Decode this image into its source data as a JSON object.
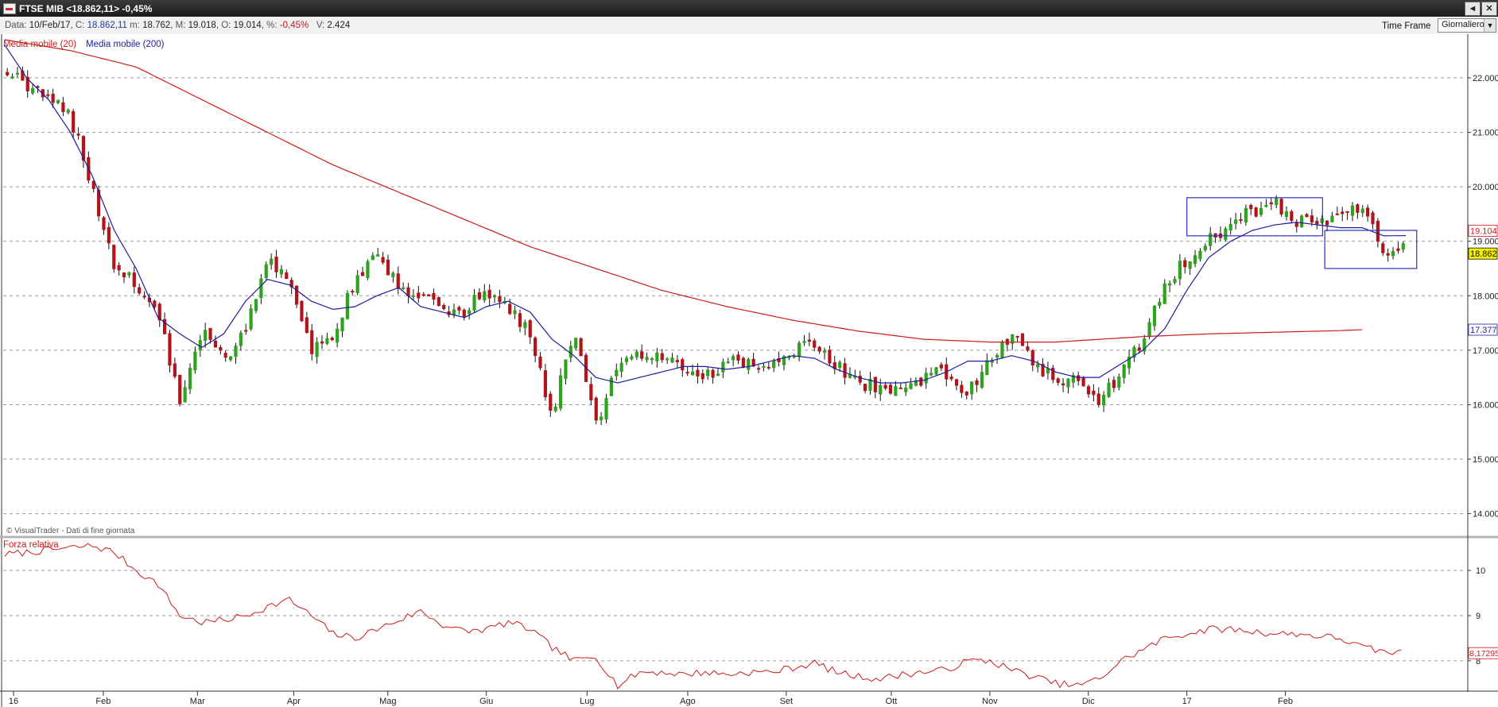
{
  "window": {
    "title": "FTSE MIB <18.862,11> -0,45%",
    "buttons": [
      "◄",
      "✕"
    ]
  },
  "infobar": {
    "data_label": "Data:",
    "date": "10/Feb/17",
    "close_label": "C:",
    "close": "18.862,11",
    "min_label": "m:",
    "min": "18.762",
    "max_label": "M:",
    "max": "19.018",
    "open_label": "O:",
    "open": "19.014",
    "pct_label": "%:",
    "pct": "-0,45%",
    "vol_label": "V:",
    "vol": "2.424",
    "timeframe_label": "Time Frame",
    "timeframe_value": "Giornaliero"
  },
  "colors": {
    "up": "#2ea31f",
    "down": "#b2141a",
    "ma20": "#cc1b1b",
    "ma200": "#1c1ca0",
    "rs": "#cc1b1b",
    "box": "#3030c0",
    "last_price_bg": "#f3f000",
    "grid": "#9a9a9a"
  },
  "chart_data": [
    {
      "type": "candlestick",
      "name": "price",
      "legend": [
        "Media mobile (20)",
        "Media mobile (200)"
      ],
      "copyright": "© VisualTrader - Dati di fine giornata",
      "x_labels": [
        "16",
        "Feb",
        "Mar",
        "Apr",
        "Mag",
        "Giu",
        "Lug",
        "Ago",
        "Set",
        "Ott",
        "Nov",
        "Dic",
        "17",
        "Feb"
      ],
      "x_label_week_index": [
        0.4,
        4.5,
        8.8,
        13.2,
        17.5,
        22,
        26.6,
        31.2,
        35.7,
        40.5,
        45,
        49.5,
        54,
        58.5
      ],
      "y_ticks": [
        "14.000",
        "15.000",
        "16.000",
        "17.000",
        "18.000",
        "19.000",
        "20.000",
        "21.000",
        "22.000"
      ],
      "y_tick_values": [
        14000,
        15000,
        16000,
        17000,
        18000,
        19000,
        20000,
        21000,
        22000
      ],
      "ylim": [
        13600,
        22700
      ],
      "weeks": 64,
      "anchors": [
        [
          0,
          22150
        ],
        [
          3,
          21300
        ],
        [
          4,
          20000
        ],
        [
          5,
          18500
        ],
        [
          6,
          18200
        ],
        [
          7,
          17700
        ],
        [
          8,
          16000
        ],
        [
          9,
          17400
        ],
        [
          10,
          16800
        ],
        [
          11,
          17400
        ],
        [
          12,
          18700
        ],
        [
          13,
          18200
        ],
        [
          14,
          17000
        ],
        [
          15,
          17200
        ],
        [
          16,
          18300
        ],
        [
          17,
          18700
        ],
        [
          18,
          18200
        ],
        [
          20,
          17800
        ],
        [
          21,
          17700
        ],
        [
          22,
          18100
        ],
        [
          23,
          17800
        ],
        [
          24,
          17300
        ],
        [
          25,
          15800
        ],
        [
          26,
          17400
        ],
        [
          27,
          15600
        ],
        [
          28,
          16700
        ],
        [
          29,
          16900
        ],
        [
          31,
          16700
        ],
        [
          32,
          16500
        ],
        [
          33,
          16800
        ],
        [
          34,
          16700
        ],
        [
          35,
          16700
        ],
        [
          36,
          17000
        ],
        [
          37,
          17100
        ],
        [
          38,
          16700
        ],
        [
          39,
          16400
        ],
        [
          40,
          16300
        ],
        [
          41,
          16200
        ],
        [
          42,
          16500
        ],
        [
          43,
          16600
        ],
        [
          44,
          16200
        ],
        [
          45,
          16900
        ],
        [
          46,
          17300
        ],
        [
          47,
          16800
        ],
        [
          48,
          16400
        ],
        [
          49,
          16500
        ],
        [
          50,
          16100
        ],
        [
          51,
          16600
        ],
        [
          52,
          17200
        ],
        [
          53,
          18200
        ],
        [
          54,
          18700
        ],
        [
          55,
          19000
        ],
        [
          56,
          19300
        ],
        [
          57,
          19550
        ],
        [
          58,
          19700
        ],
        [
          59,
          19350
        ],
        [
          60,
          19300
        ],
        [
          61,
          19500
        ],
        [
          62,
          19700
        ],
        [
          63,
          18800
        ],
        [
          64,
          18900
        ]
      ],
      "ma20_anchors": [
        [
          0,
          22600
        ],
        [
          1,
          22000
        ],
        [
          2,
          21600
        ],
        [
          3,
          21000
        ],
        [
          4,
          20200
        ],
        [
          5,
          19200
        ],
        [
          6,
          18500
        ],
        [
          7,
          17600
        ],
        [
          8,
          17300
        ],
        [
          9,
          17050
        ],
        [
          10,
          17300
        ],
        [
          11,
          17900
        ],
        [
          12,
          18300
        ],
        [
          13,
          18200
        ],
        [
          14,
          17900
        ],
        [
          15,
          17750
        ],
        [
          16,
          17800
        ],
        [
          17,
          18000
        ],
        [
          18,
          18150
        ],
        [
          19,
          17800
        ],
        [
          20,
          17700
        ],
        [
          21,
          17600
        ],
        [
          22,
          17800
        ],
        [
          23,
          17900
        ],
        [
          24,
          17700
        ],
        [
          25,
          17200
        ],
        [
          26,
          16900
        ],
        [
          27,
          16500
        ],
        [
          28,
          16400
        ],
        [
          29,
          16500
        ],
        [
          30,
          16600
        ],
        [
          31,
          16700
        ],
        [
          32,
          16700
        ],
        [
          33,
          16650
        ],
        [
          34,
          16700
        ],
        [
          35,
          16800
        ],
        [
          36,
          16900
        ],
        [
          37,
          16850
        ],
        [
          38,
          16650
        ],
        [
          39,
          16500
        ],
        [
          40,
          16400
        ],
        [
          41,
          16400
        ],
        [
          42,
          16450
        ],
        [
          43,
          16600
        ],
        [
          44,
          16800
        ],
        [
          45,
          16800
        ],
        [
          46,
          16900
        ],
        [
          47,
          16800
        ],
        [
          48,
          16600
        ],
        [
          49,
          16500
        ],
        [
          50,
          16500
        ],
        [
          51,
          16750
        ],
        [
          52,
          17000
        ],
        [
          53,
          17400
        ],
        [
          54,
          18100
        ],
        [
          55,
          18700
        ],
        [
          56,
          19000
        ],
        [
          57,
          19200
        ],
        [
          58,
          19300
        ],
        [
          59,
          19350
        ],
        [
          60,
          19300
        ],
        [
          61,
          19250
        ],
        [
          62,
          19250
        ],
        [
          63,
          19100
        ],
        [
          64,
          19104
        ]
      ],
      "ma200_anchors": [
        [
          0,
          22700
        ],
        [
          3,
          22500
        ],
        [
          6,
          22200
        ],
        [
          9,
          21600
        ],
        [
          12,
          21000
        ],
        [
          15,
          20400
        ],
        [
          18,
          19900
        ],
        [
          21,
          19400
        ],
        [
          24,
          18900
        ],
        [
          27,
          18500
        ],
        [
          30,
          18100
        ],
        [
          33,
          17800
        ],
        [
          36,
          17550
        ],
        [
          39,
          17350
        ],
        [
          42,
          17200
        ],
        [
          45,
          17150
        ],
        [
          48,
          17150
        ],
        [
          50,
          17200
        ],
        [
          52,
          17250
        ],
        [
          55,
          17300
        ],
        [
          58,
          17330
        ],
        [
          61,
          17360
        ],
        [
          62,
          17377
        ]
      ],
      "last_values": {
        "ma20": "19.104",
        "price": "18.862",
        "ma200": "17.377"
      },
      "boxes": [
        {
          "x": [
            54,
            60.2
          ],
          "y": [
            19100,
            19800
          ]
        },
        {
          "x": [
            60.3,
            64.5
          ],
          "y": [
            18500,
            19200
          ]
        }
      ]
    },
    {
      "type": "line",
      "name": "Forza relativa",
      "title": "Forza relativa",
      "y_ticks": [
        "8",
        "9",
        "10"
      ],
      "y_tick_values": [
        8,
        9,
        10
      ],
      "ylim": [
        7.4,
        10.6
      ],
      "last_value": "8,17295",
      "anchors": [
        [
          0,
          10.35
        ],
        [
          2,
          10.45
        ],
        [
          4,
          10.55
        ],
        [
          5,
          10.4
        ],
        [
          6,
          10.0
        ],
        [
          7,
          9.7
        ],
        [
          8,
          9.0
        ],
        [
          9,
          8.85
        ],
        [
          10,
          8.9
        ],
        [
          11,
          9.0
        ],
        [
          12,
          9.2
        ],
        [
          13,
          9.35
        ],
        [
          14,
          9.0
        ],
        [
          15,
          8.6
        ],
        [
          16,
          8.5
        ],
        [
          17,
          8.7
        ],
        [
          18,
          8.9
        ],
        [
          19,
          9.1
        ],
        [
          20,
          8.8
        ],
        [
          21,
          8.65
        ],
        [
          22,
          8.7
        ],
        [
          23,
          8.85
        ],
        [
          24,
          8.7
        ],
        [
          25,
          8.3
        ],
        [
          26,
          8.0
        ],
        [
          27,
          8.1
        ],
        [
          28,
          7.45
        ],
        [
          29,
          7.75
        ],
        [
          30,
          7.75
        ],
        [
          31,
          7.7
        ],
        [
          32,
          7.75
        ],
        [
          33,
          7.7
        ],
        [
          34,
          7.75
        ],
        [
          35,
          7.75
        ],
        [
          36,
          7.85
        ],
        [
          37,
          7.95
        ],
        [
          38,
          7.75
        ],
        [
          39,
          7.65
        ],
        [
          40,
          7.6
        ],
        [
          41,
          7.7
        ],
        [
          42,
          7.75
        ],
        [
          43,
          7.8
        ],
        [
          44,
          8.0
        ],
        [
          45,
          8.0
        ],
        [
          46,
          7.8
        ],
        [
          47,
          7.65
        ],
        [
          48,
          7.5
        ],
        [
          49,
          7.45
        ],
        [
          50,
          7.6
        ],
        [
          51,
          8.0
        ],
        [
          52,
          8.25
        ],
        [
          53,
          8.5
        ],
        [
          54,
          8.6
        ],
        [
          55,
          8.7
        ],
        [
          56,
          8.7
        ],
        [
          57,
          8.65
        ],
        [
          58,
          8.6
        ],
        [
          59,
          8.6
        ],
        [
          60,
          8.55
        ],
        [
          61,
          8.5
        ],
        [
          62,
          8.3
        ],
        [
          63,
          8.2
        ],
        [
          64,
          8.17
        ]
      ]
    }
  ]
}
